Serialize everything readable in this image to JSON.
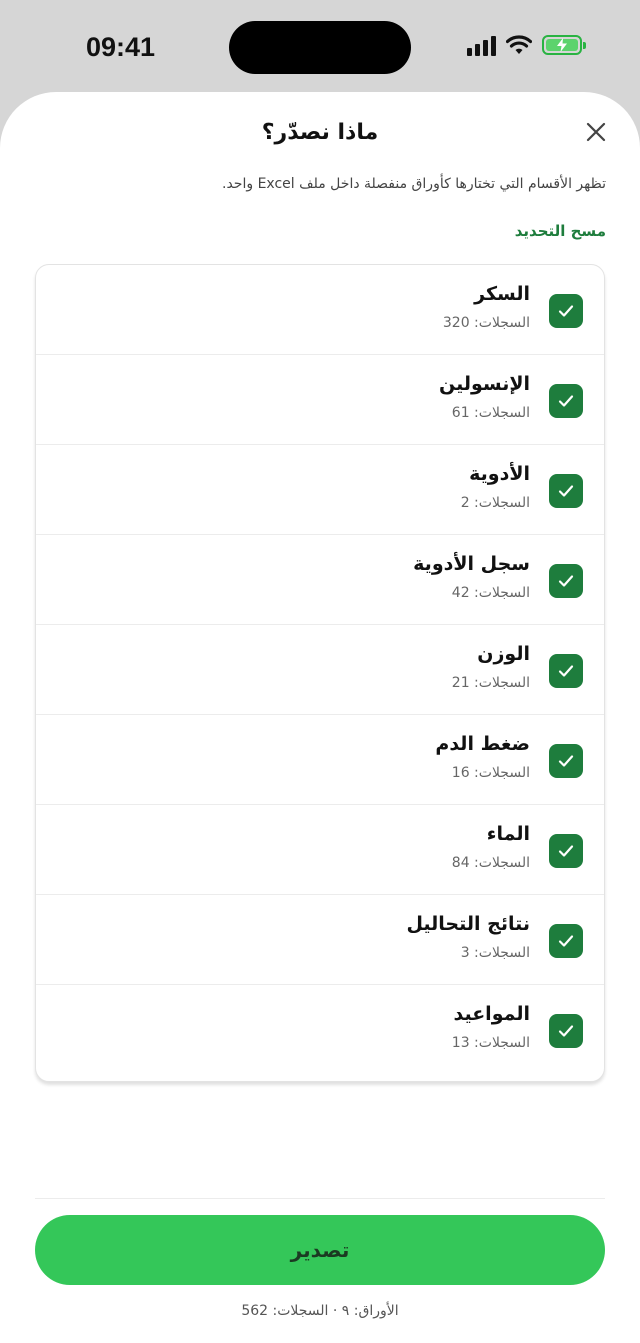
{
  "status": {
    "time": "09:41"
  },
  "sheet": {
    "title": "ماذا نصدّر؟",
    "subtitle": "تظهر الأقسام التي تختارها كأوراق منفصلة داخل ملف Excel واحد.",
    "clear_label": "مسح التحديد"
  },
  "items": [
    {
      "label": "السكر",
      "count": "السجلات: 320",
      "checked": true
    },
    {
      "label": "الإنسولين",
      "count": "السجلات: 61",
      "checked": true
    },
    {
      "label": "الأدوية",
      "count": "السجلات: 2",
      "checked": true
    },
    {
      "label": "سجل الأدوية",
      "count": "السجلات: 42",
      "checked": true
    },
    {
      "label": "الوزن",
      "count": "السجلات: 21",
      "checked": true
    },
    {
      "label": "ضغط الدم",
      "count": "السجلات: 16",
      "checked": true
    },
    {
      "label": "الماء",
      "count": "السجلات: 84",
      "checked": true
    },
    {
      "label": "نتائج التحاليل",
      "count": "السجلات: 3",
      "checked": true
    },
    {
      "label": "المواعيد",
      "count": "السجلات: 13",
      "checked": true
    }
  ],
  "footer": {
    "export_label": "تصدير",
    "summary": "الأوراق: ٩ · السجلات: 562"
  },
  "colors": {
    "accent": "#34c759",
    "check": "#1e7d3d"
  },
  "icons": {
    "close": "close-icon",
    "check": "checkmark-icon"
  }
}
